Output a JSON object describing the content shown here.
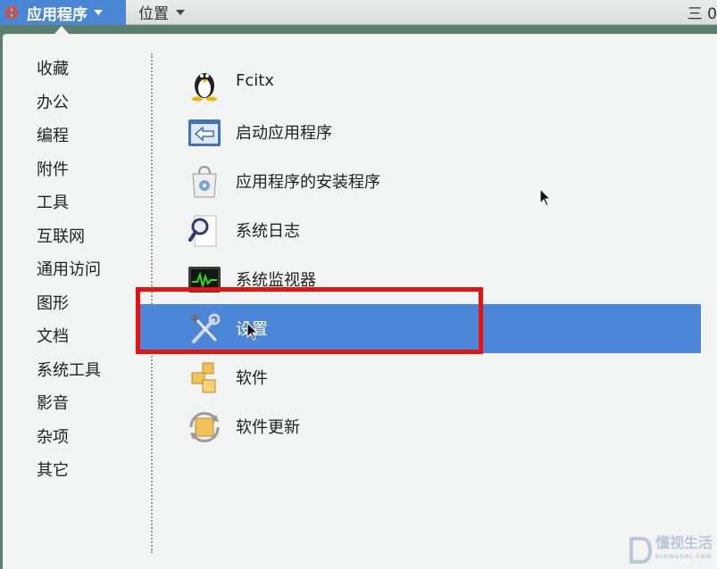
{
  "topbar": {
    "applications_label": "应用程序",
    "places_label": "位置",
    "tray_text": "三 0"
  },
  "categories": [
    "收藏",
    "办公",
    "编程",
    "附件",
    "工具",
    "互联网",
    "通用访问",
    "图形",
    "文档",
    "系统工具",
    "影音",
    "杂项",
    "其它"
  ],
  "items": [
    {
      "label": "Fcitx",
      "icon": "penguin-icon"
    },
    {
      "label": "启动应用程序",
      "icon": "startup-apps-icon"
    },
    {
      "label": "应用程序的安装程序",
      "icon": "app-installer-icon"
    },
    {
      "label": "系统日志",
      "icon": "log-viewer-icon"
    },
    {
      "label": "系统监视器",
      "icon": "system-monitor-icon"
    },
    {
      "label": "设置",
      "icon": "settings-tools-icon",
      "selected": true
    },
    {
      "label": "软件",
      "icon": "software-icon"
    },
    {
      "label": "软件更新",
      "icon": "software-update-icon"
    }
  ],
  "watermark": {
    "text": "懂视生活",
    "sub": "DIONGSHI.COM"
  },
  "colors": {
    "accent": "#4b86d9",
    "highlight_box": "#e8130f",
    "menu_bg": "#f2f3f3"
  }
}
